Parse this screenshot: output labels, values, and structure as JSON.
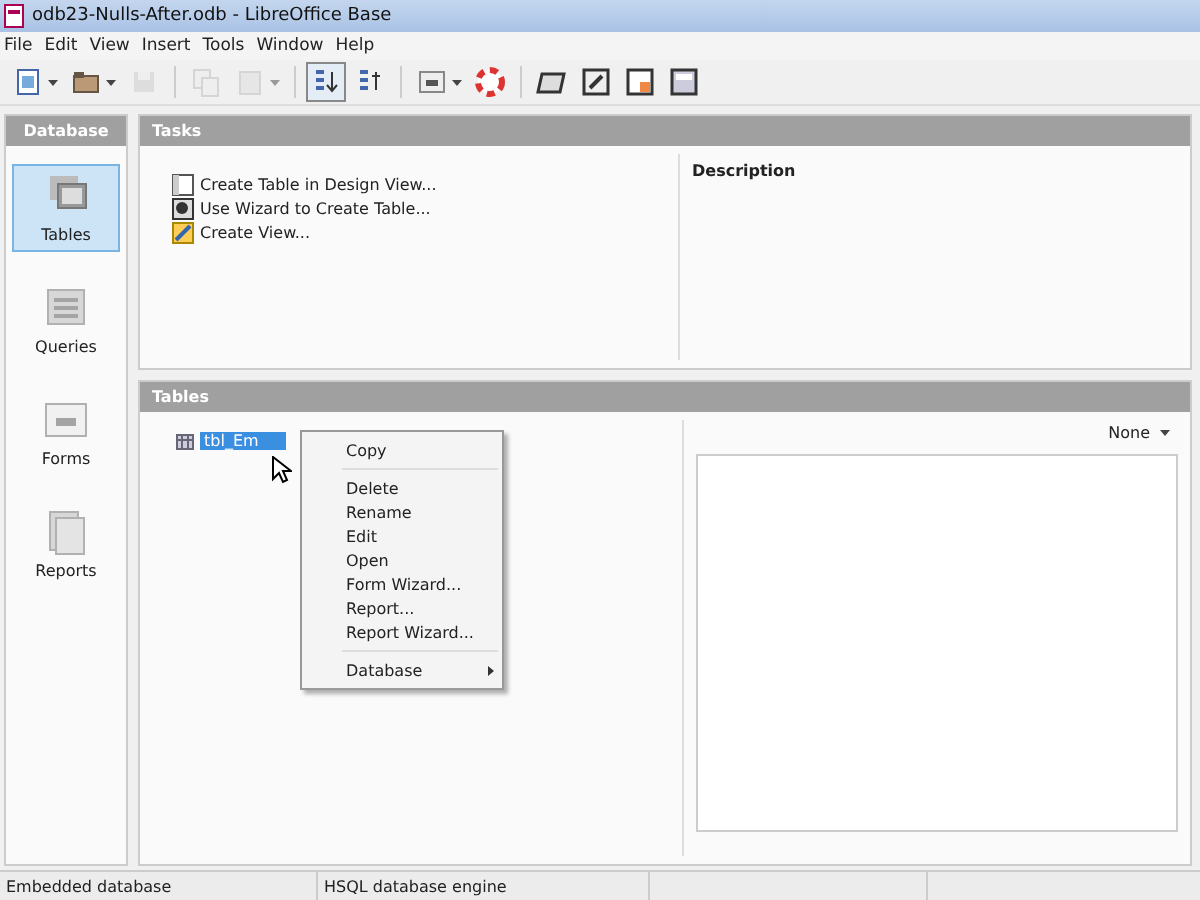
{
  "window": {
    "title": "odb23-Nulls-After.odb - LibreOffice Base"
  },
  "menu_bar": [
    "File",
    "Edit",
    "View",
    "Insert",
    "Tools",
    "Window",
    "Help"
  ],
  "toolbar": [
    {
      "kind": "new",
      "dropdown": true,
      "disabled": false,
      "selected": false
    },
    {
      "kind": "open",
      "dropdown": true,
      "disabled": false,
      "selected": false
    },
    {
      "kind": "save",
      "dropdown": false,
      "disabled": true,
      "selected": false
    },
    {
      "kind": "copy",
      "dropdown": false,
      "disabled": true,
      "selected": false
    },
    {
      "kind": "paste",
      "dropdown": true,
      "disabled": true,
      "selected": false
    },
    {
      "kind": "sortasc",
      "dropdown": false,
      "disabled": false,
      "selected": true
    },
    {
      "kind": "sortdesc",
      "dropdown": false,
      "disabled": false,
      "selected": false
    },
    {
      "kind": "form",
      "dropdown": true,
      "disabled": false,
      "selected": false
    },
    {
      "kind": "help",
      "dropdown": false,
      "disabled": false,
      "selected": false
    },
    {
      "kind": "table",
      "dropdown": false,
      "disabled": false,
      "selected": false
    },
    {
      "kind": "edit",
      "dropdown": false,
      "disabled": false,
      "selected": false
    },
    {
      "kind": "report",
      "dropdown": false,
      "disabled": false,
      "selected": false
    },
    {
      "kind": "db",
      "dropdown": false,
      "disabled": false,
      "selected": false
    }
  ],
  "sidebar": {
    "title": "Database",
    "items": [
      {
        "label": "Tables",
        "kind": "tables",
        "selected": true
      },
      {
        "label": "Queries",
        "kind": "queries",
        "selected": false
      },
      {
        "label": "Forms",
        "kind": "forms",
        "selected": false
      },
      {
        "label": "Reports",
        "kind": "reports",
        "selected": false
      }
    ]
  },
  "tasks": {
    "title": "Tasks",
    "items": [
      {
        "label": "Create Table in Design View...",
        "kind": "design"
      },
      {
        "label": "Use Wizard to Create Table...",
        "kind": "wizard"
      },
      {
        "label": "Create View...",
        "kind": "view"
      }
    ],
    "description_label": "Description"
  },
  "tables": {
    "title": "Tables",
    "items": [
      {
        "label": "tbl_Em",
        "selected": true
      }
    ],
    "preview": "None"
  },
  "context_menu": {
    "groups": [
      [
        {
          "label": "Copy",
          "submenu": false
        }
      ],
      [
        {
          "label": "Delete",
          "submenu": false
        },
        {
          "label": "Rename",
          "submenu": false
        },
        {
          "label": "Edit",
          "submenu": false
        },
        {
          "label": "Open",
          "submenu": false
        },
        {
          "label": "Form Wizard...",
          "submenu": false
        },
        {
          "label": "Report...",
          "submenu": false
        },
        {
          "label": "Report Wizard...",
          "submenu": false
        }
      ],
      [
        {
          "label": "Database",
          "submenu": true
        }
      ]
    ]
  },
  "status_bar": [
    "Embedded database",
    "HSQL database engine"
  ]
}
